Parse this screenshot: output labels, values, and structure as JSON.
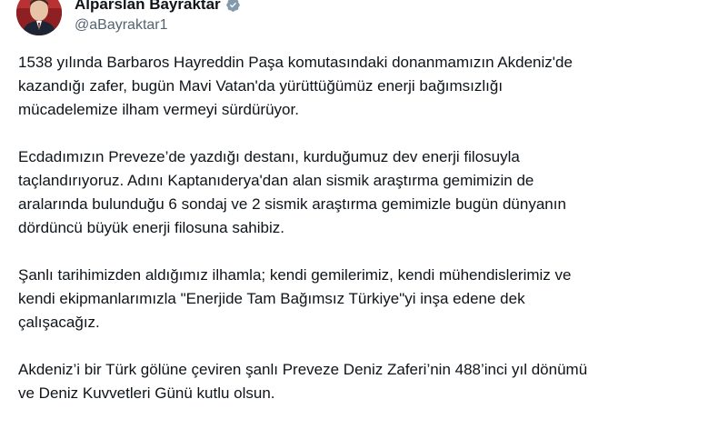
{
  "author": {
    "display_name": "Alparslan Bayraktar",
    "handle": "@aBayraktar1",
    "verified_icon": "verified-badge-icon"
  },
  "colors": {
    "text": "#0f1419",
    "handle": "#536471",
    "verified": "#829aab"
  },
  "tweet": {
    "paragraphs": [
      "1538 yılında Barbaros Hayreddin Paşa komutasındaki donanmamızın Akdeniz'de\nkazandığı zafer, bugün Mavi Vatan'da yürüttüğümüz enerji bağımsızlığı\nmücadelemize ilham vermeyi sürdürüyor.",
      "Ecdadımızın Preveze’de yazdığı destanı, kurduğumuz dev enerji filosuyla\ntaçlandırıyoruz. Adını Kaptanıderya'dan alan sismik araştırma gemimizin de\naralarında bulunduğu 6 sondaj ve 2 sismik araştırma gemimizle bugün dünyanın\ndördüncü büyük enerji filosuna sahibiz.",
      "Şanlı tarihimizden aldığımız ilhamla; kendi gemilerimiz, kendi mühendislerimiz ve\nkendi ekipmanlarımızla \"Enerjide Tam Bağımsız Türkiye\"yi inşa edene dek\nçalışacağız.",
      "Akdeniz’i bir Türk gölüne çeviren şanlı Preveze Deniz Zaferi’nin 488’inci yıl dönümü\nve Deniz Kuvvetleri Günü kutlu olsun."
    ]
  }
}
